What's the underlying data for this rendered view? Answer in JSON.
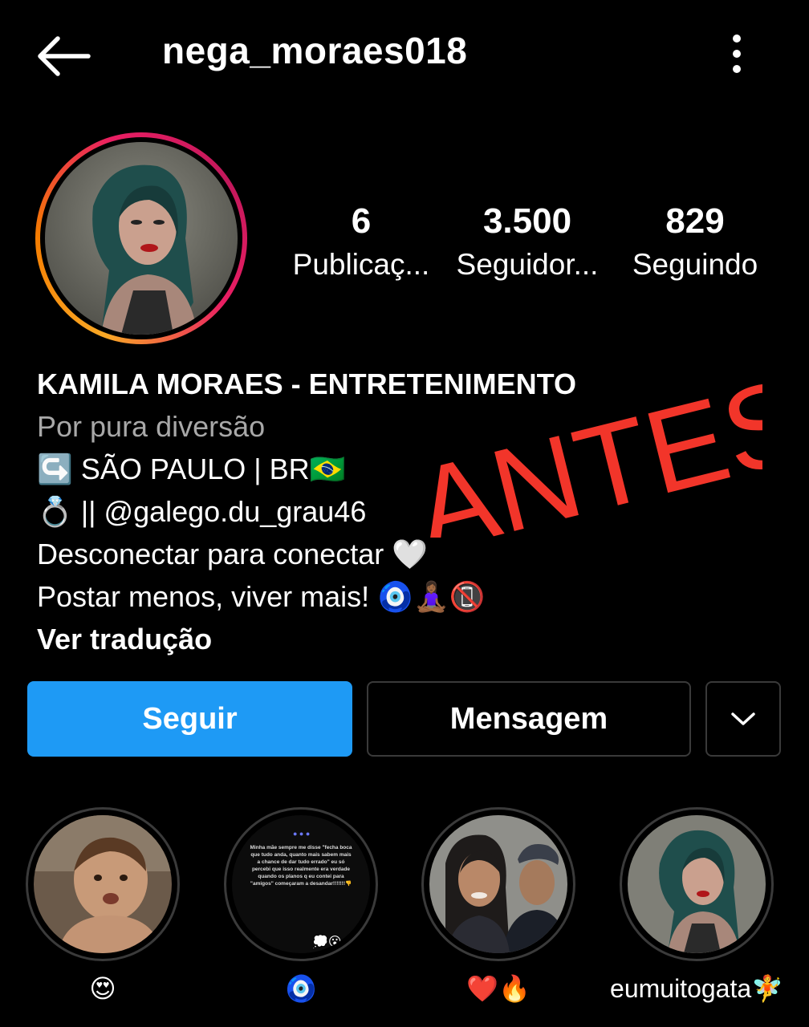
{
  "header": {
    "username": "nega_moraes018",
    "back_icon": "back-arrow-icon",
    "more_icon": "more-vertical-icon"
  },
  "stats": [
    {
      "value": "6",
      "label": "Publicaç..."
    },
    {
      "value": "3.500",
      "label": "Seguidor..."
    },
    {
      "value": "829",
      "label": "Seguindo"
    }
  ],
  "bio": {
    "name": "KAMILA MORAES - ENTRETENIMENTO",
    "category": "Por pura diversão",
    "line1_emoji": "↪️",
    "line1_text": " SÃO PAULO | BR🇧🇷",
    "line2_emoji": "💍",
    "line2_text": " || @galego.du_grau46",
    "line3": "Desconectar para conectar 🤍",
    "line4": "Postar menos, viver mais! 🧿🧘🏾‍♀️📵",
    "translate": "Ver tradução"
  },
  "overlay_text": "ANTES",
  "buttons": {
    "follow": "Seguir",
    "message": "Mensagem",
    "dropdown_icon": "chevron-down-icon"
  },
  "highlights": [
    {
      "label": "😍"
    },
    {
      "label": "🧿",
      "story_text": "Minha mãe sempre me disse \"fecha boca que tudo anda, quanto mais sabem mais a chance de dar tudo errado\" eu só percebi que isso realmente era verdade quando os planos q eu contei para \"amigos\" começaram a desandar!!!!!!!👎"
    },
    {
      "label": "❤️🔥"
    },
    {
      "label": "eumuitogata🧚"
    }
  ],
  "colors": {
    "background": "#000000",
    "follow_button": "#1e9af5",
    "overlay_red": "#f2352a"
  }
}
